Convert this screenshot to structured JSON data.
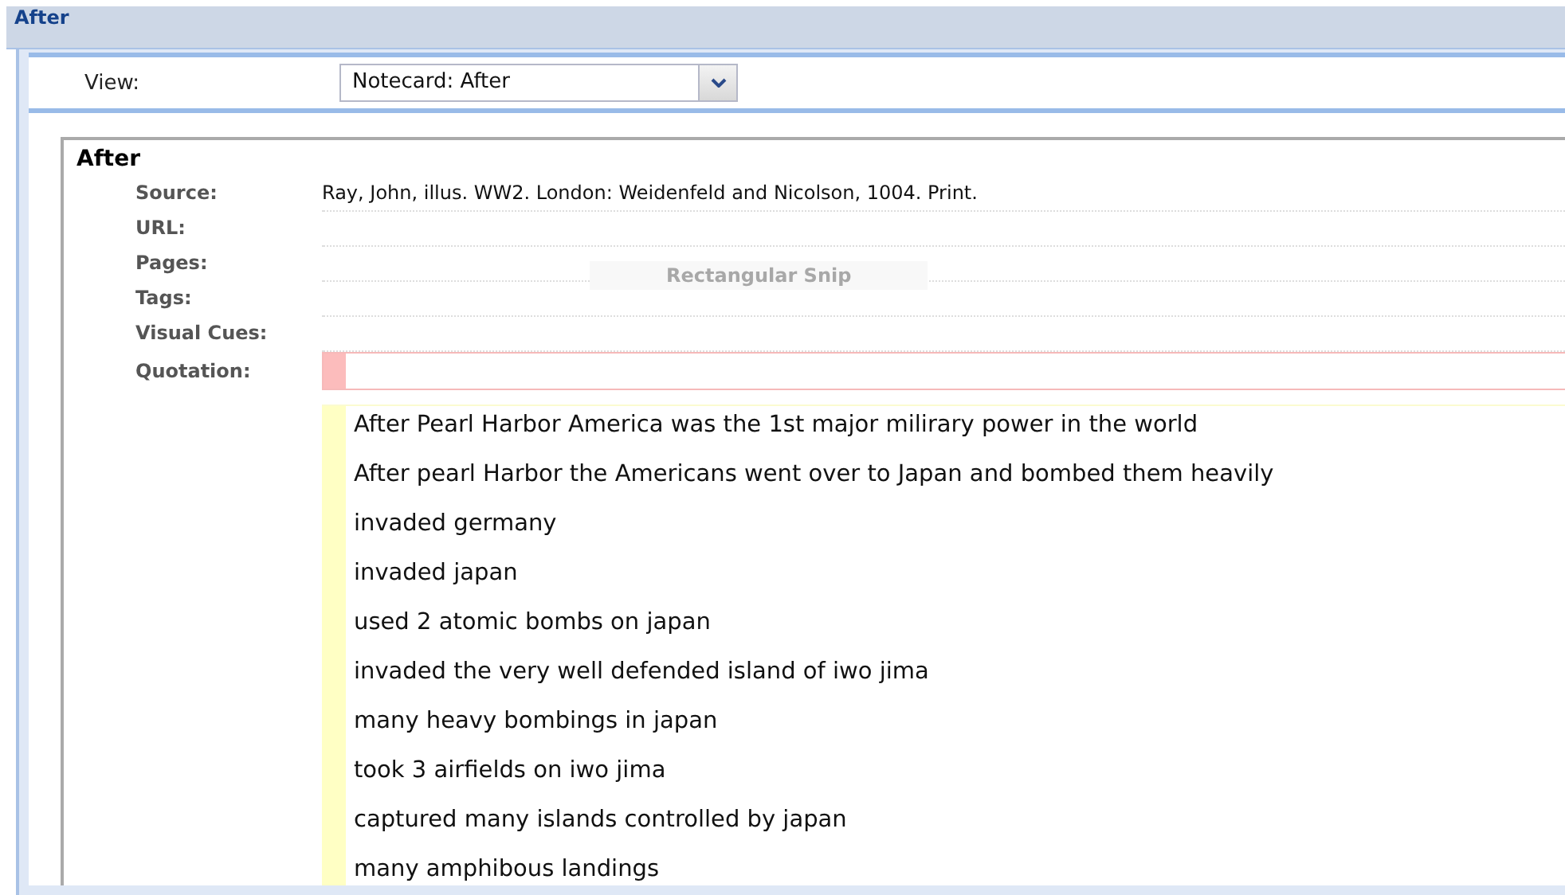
{
  "window": {
    "title": "After"
  },
  "view": {
    "label": "View:",
    "value": "Notecard: After"
  },
  "notecard": {
    "title": "After",
    "fields": [
      {
        "kind": "text",
        "label": "Source:",
        "value": "Ray, John, illus. WW2. London: Weidenfeld and Nicolson, 1004. Print."
      },
      {
        "kind": "text",
        "label": "URL:"
      },
      {
        "kind": "text",
        "label": "Pages:"
      },
      {
        "kind": "text",
        "label": "Tags:"
      },
      {
        "kind": "text",
        "label": "Visual Cues:"
      },
      {
        "kind": "quotation",
        "label": "Quotation:"
      }
    ],
    "overlay_hint": "Rectangular Snip",
    "notes": [
      "After Pearl Harbor America was the 1st major milirary power in the world",
      "After pearl Harbor the Americans went over to Japan and bombed them heavily",
      "invaded germany",
      "invaded japan",
      "used 2 atomic bombs on japan",
      "invaded the very well defended island of iwo jima",
      "many heavy bombings in japan",
      "took 3 airfields on iwo jima",
      "captured many islands controlled by japan",
      "many amphibous landings"
    ]
  }
}
